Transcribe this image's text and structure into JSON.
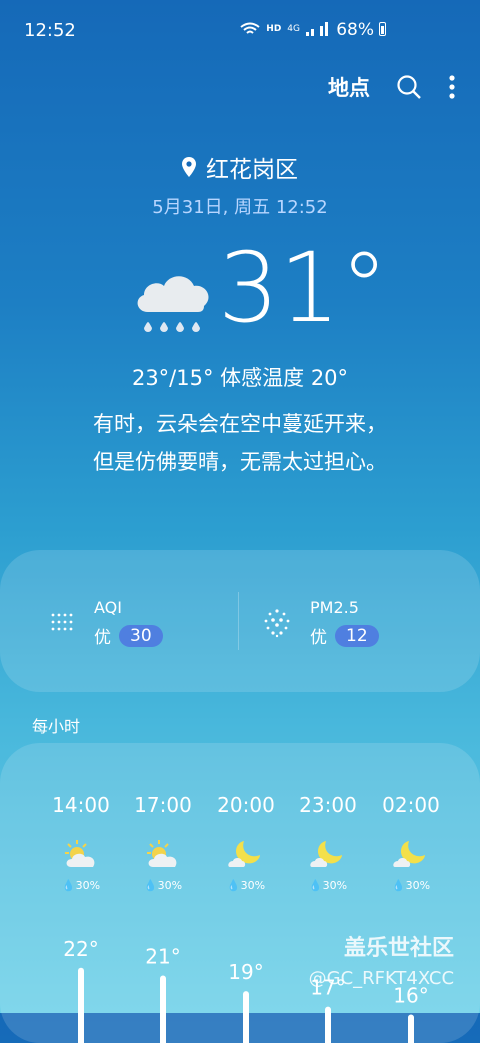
{
  "status": {
    "time": "12:52",
    "hd": "HD",
    "net": "4G",
    "battery": "68%"
  },
  "header": {
    "places_label": "地点"
  },
  "location": {
    "name": "红花岗区",
    "datetime": "5月31日, 周五 12:52"
  },
  "current": {
    "temperature": "31°",
    "range_feels": "23°/15° 体感温度 20°",
    "summary_line1": "有时，云朵会在空中蔓延开来，",
    "summary_line2": "但是仿佛要晴，无需太过担心。",
    "icon": "rain-cloud-icon"
  },
  "air_quality": [
    {
      "name": "AQI",
      "level": "优",
      "value": "30",
      "icon": "aqi-dots-icon"
    },
    {
      "name": "PM2.5",
      "level": "优",
      "value": "12",
      "icon": "pm25-dots-icon"
    }
  ],
  "hourly": {
    "label": "每小时",
    "items": [
      {
        "time": "14:00",
        "icon": "partly-sunny-icon",
        "precip": "30%",
        "temp": "22°"
      },
      {
        "time": "17:00",
        "icon": "partly-sunny-icon",
        "precip": "30%",
        "temp": "21°"
      },
      {
        "time": "20:00",
        "icon": "moon-cloud-icon",
        "precip": "30%",
        "temp": "19°"
      },
      {
        "time": "23:00",
        "icon": "moon-cloud-icon",
        "precip": "30%",
        "temp": "17°"
      },
      {
        "time": "02:00",
        "icon": "moon-cloud-icon",
        "precip": "30%",
        "temp": "16°"
      }
    ]
  },
  "watermark": {
    "line1": "盖乐世社区",
    "line2": "@GC_RFKT4XCC"
  },
  "colors": {
    "badge": "#4f7fe0",
    "sun": "#f3d34a",
    "moon": "#f3e04a"
  }
}
